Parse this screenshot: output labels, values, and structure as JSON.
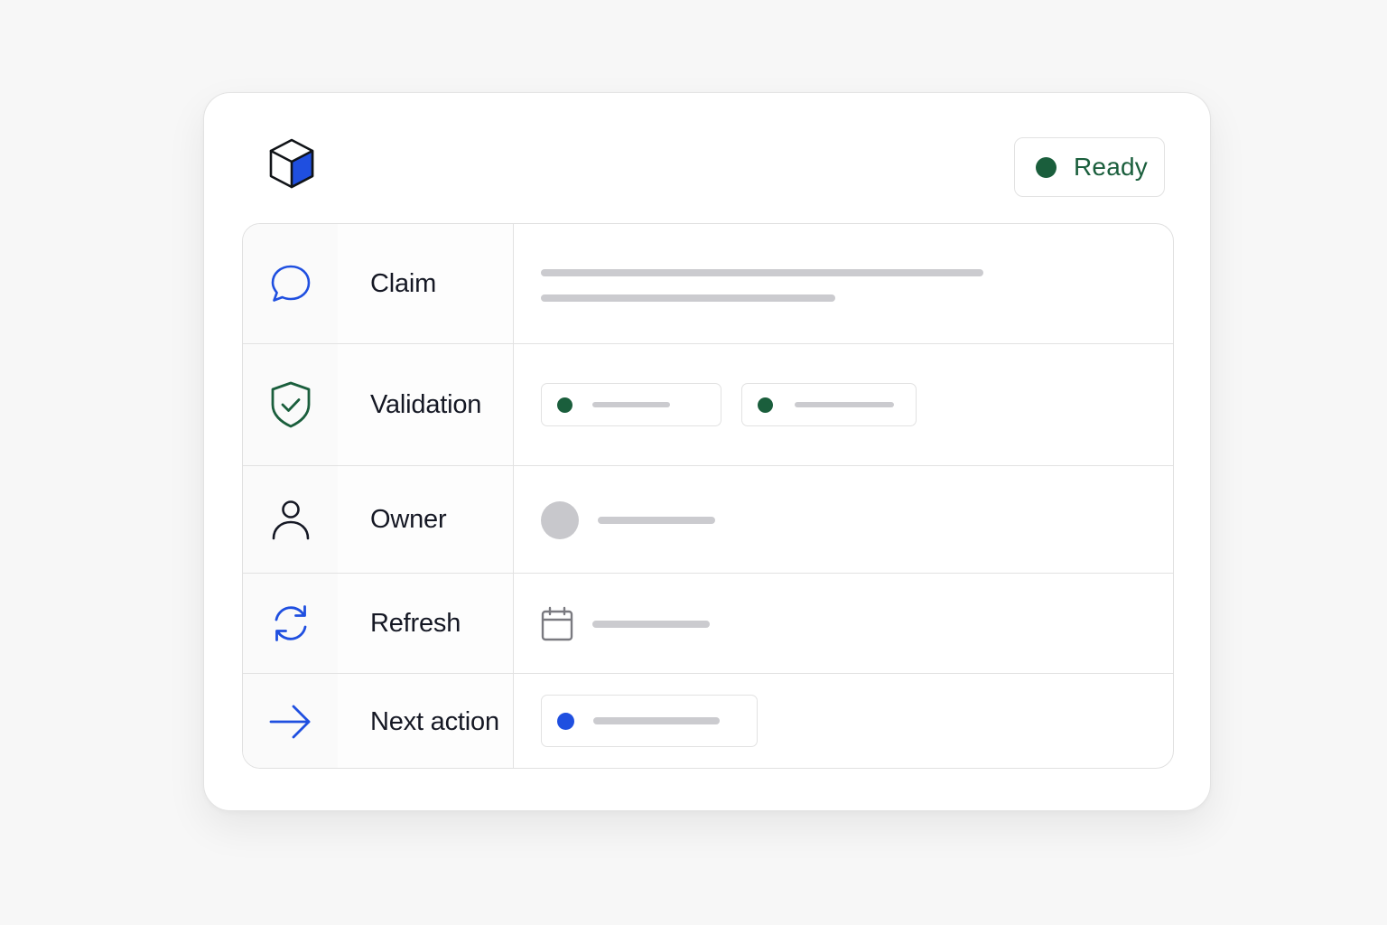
{
  "header": {
    "logo_icon": "cube-icon",
    "status": {
      "label": "Ready",
      "color": "#1a5e3c"
    }
  },
  "rows": [
    {
      "icon": "chat-bubble-icon",
      "label": "Claim",
      "icon_color": "#1f4fe0"
    },
    {
      "icon": "shield-check-icon",
      "label": "Validation",
      "icon_color": "#1a5e3c"
    },
    {
      "icon": "user-icon",
      "label": "Owner",
      "icon_color": "#151824"
    },
    {
      "icon": "refresh-icon",
      "label": "Refresh",
      "icon_color": "#1f4fe0"
    },
    {
      "icon": "arrow-right-icon",
      "label": "Next action",
      "icon_color": "#1f4fe0"
    }
  ],
  "values": {
    "validation_chip_dot_color": "#1a5e3c",
    "refresh_icon": "calendar-icon",
    "next_action_dot_color": "#1f4fe0"
  },
  "colors": {
    "accent_blue": "#1f4fe0",
    "success_green": "#1a5e3c",
    "placeholder_gray": "#cbcbcf"
  }
}
